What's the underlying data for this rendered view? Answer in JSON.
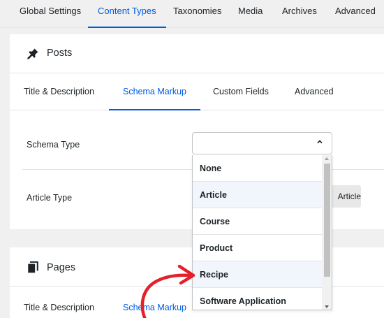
{
  "topnav": {
    "tabs": [
      {
        "label": "Global Settings"
      },
      {
        "label": "Content Types"
      },
      {
        "label": "Taxonomies"
      },
      {
        "label": "Media"
      },
      {
        "label": "Archives"
      },
      {
        "label": "Advanced"
      }
    ],
    "active": "Content Types"
  },
  "posts": {
    "title": "Posts",
    "icon": "pin-icon",
    "tabs": [
      {
        "label": "Title & Description"
      },
      {
        "label": "Schema Markup"
      },
      {
        "label": "Custom Fields"
      },
      {
        "label": "Advanced"
      }
    ],
    "active_tab": "Schema Markup",
    "schema_type_label": "Schema Type",
    "article_type_label": "Article Type",
    "article_type_value": "Article"
  },
  "dropdown": {
    "options": [
      "None",
      "Article",
      "Course",
      "Product",
      "Recipe",
      "Software Application"
    ],
    "highlighted": "Recipe"
  },
  "pages": {
    "title": "Pages",
    "icon": "pages-icon",
    "tabs": [
      {
        "label": "Title & Description"
      },
      {
        "label": "Schema Markup"
      }
    ]
  },
  "colors": {
    "accent": "#005ae0",
    "annotation_arrow": "#e4202a"
  }
}
